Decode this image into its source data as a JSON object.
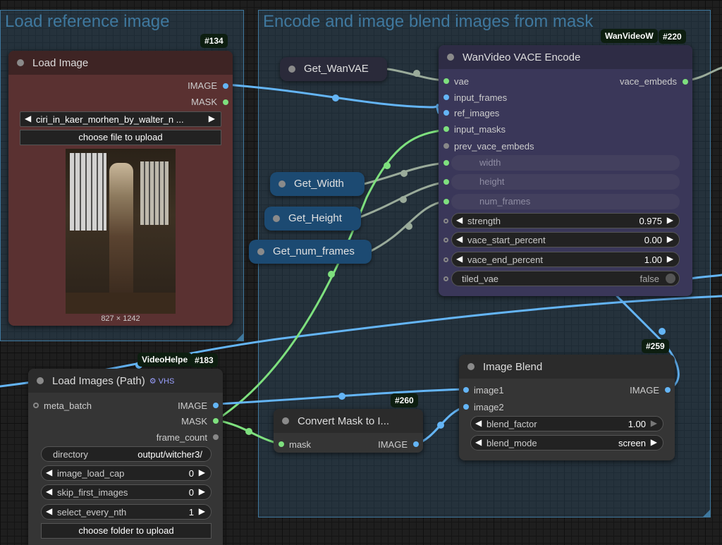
{
  "groups": {
    "load_ref": {
      "title": "Load reference image"
    },
    "encode_blend": {
      "title": "Encode and image blend images from mask"
    }
  },
  "load_image": {
    "badge": "#134",
    "title": "Load Image",
    "outputs": [
      "IMAGE",
      "MASK"
    ],
    "file_value": "ciri_in_kaer_morhen_by_walter_n ...",
    "upload_label": "choose file to upload",
    "image_size": "827 × 1242"
  },
  "get_nodes": {
    "wanvae": "Get_WanVAE",
    "width": "Get_Width",
    "height": "Get_Height",
    "num_frames": "Get_num_frames"
  },
  "vace_encode": {
    "badge_title": "WanVideoW",
    "badge": "#220",
    "title": "WanVideo VACE Encode",
    "inputs": [
      "vae",
      "input_frames",
      "ref_images",
      "input_masks",
      "prev_vace_embeds"
    ],
    "output": "vace_embeds",
    "converted": [
      "width",
      "height",
      "num_frames"
    ],
    "widgets": [
      {
        "label": "strength",
        "value": "0.975"
      },
      {
        "label": "vace_start_percent",
        "value": "0.00"
      },
      {
        "label": "vace_end_percent",
        "value": "1.00"
      }
    ],
    "toggle": {
      "label": "tiled_vae",
      "value": "false"
    }
  },
  "image_blend": {
    "badge": "#259",
    "title": "Image Blend",
    "inputs": [
      "image1",
      "image2"
    ],
    "output": "IMAGE",
    "widgets": [
      {
        "label": "blend_factor",
        "value": "1.00"
      },
      {
        "label": "blend_mode",
        "value": "screen"
      }
    ]
  },
  "convert_mask": {
    "badge": "#260",
    "title": "Convert Mask to I...",
    "input": "mask",
    "output": "IMAGE"
  },
  "load_images_path": {
    "badge_title": "VideoHelpe",
    "badge": "#183",
    "title": "Load Images (Path)",
    "title_icons": "⚙ VHS",
    "input": "meta_batch",
    "outputs": [
      "IMAGE",
      "MASK",
      "frame_count"
    ],
    "directory": {
      "label": "directory",
      "value": "output/witcher3/"
    },
    "widgets": [
      {
        "label": "image_load_cap",
        "value": "0"
      },
      {
        "label": "skip_first_images",
        "value": "0"
      },
      {
        "label": "select_every_nth",
        "value": "1"
      }
    ],
    "upload_label": "choose folder to upload"
  },
  "colors": {
    "group_border": "#3f789e",
    "image_wire": "#64b5f6",
    "mask_wire": "#7ee07e",
    "vae_wire": "#9aab9a",
    "load_image_body": "#5a3131",
    "vace_body": "#3a3759",
    "get_node": "#1c4a72"
  }
}
